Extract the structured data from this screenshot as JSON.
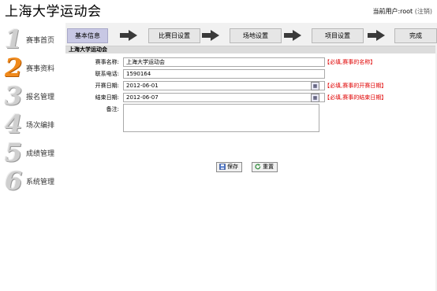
{
  "header": {
    "title": "上海大学运动会",
    "user_prefix": "当前用户:",
    "username": "root",
    "logout_label": "(注销)"
  },
  "sidebar": {
    "items": [
      {
        "number": "1",
        "label": "赛事首页",
        "active": false
      },
      {
        "number": "2",
        "label": "赛事资料",
        "active": true
      },
      {
        "number": "3",
        "label": "报名管理",
        "active": false
      },
      {
        "number": "4",
        "label": "场次编排",
        "active": false
      },
      {
        "number": "5",
        "label": "成绩管理",
        "active": false
      },
      {
        "number": "6",
        "label": "系统管理",
        "active": false
      }
    ]
  },
  "steps": [
    "基本信息",
    "比赛日设置",
    "场地设置",
    "项目设置",
    "完成"
  ],
  "panel": {
    "title": "上海大学运动会",
    "fields": {
      "name": {
        "label": "赛事名称:",
        "value": "上海大学运动会",
        "hint": "【必填,赛事的名称】"
      },
      "phone": {
        "label": "联系电话:",
        "value": "1590164"
      },
      "start": {
        "label": "开赛日期:",
        "value": "2012-06-01",
        "hint": "【必填,赛事的开赛日期】"
      },
      "end": {
        "label": "结束日期:",
        "value": "2012-06-07",
        "hint": "【必填,赛事的结束日期】"
      },
      "notes": {
        "label": "备注:"
      }
    },
    "save_label": "保存",
    "reset_label": "重置"
  },
  "colors": {
    "accent": "#f08a1c",
    "active_step": "#c8c8e4",
    "hint": "#e00000",
    "main_bg": "#f1f1f1"
  }
}
